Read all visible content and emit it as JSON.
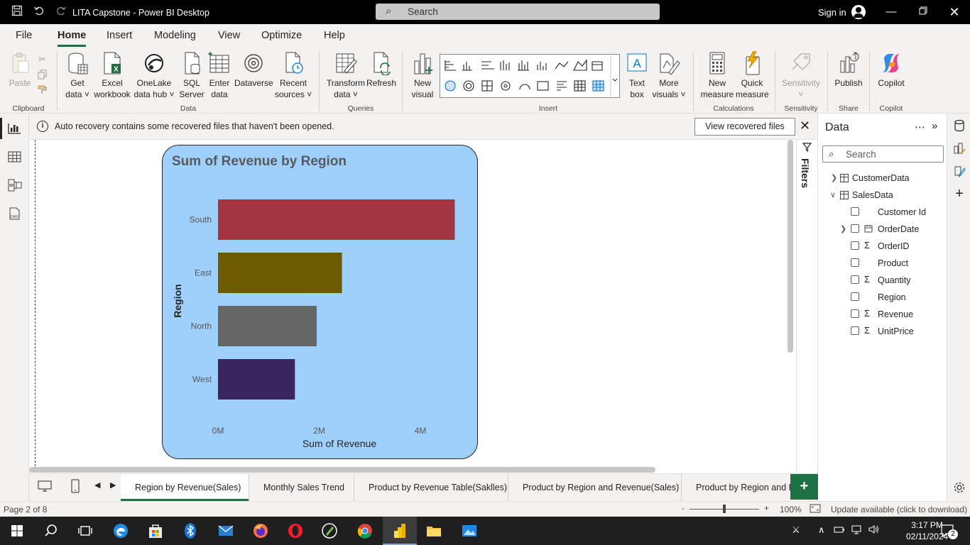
{
  "window": {
    "title": "LITA Capstone - Power BI Desktop",
    "search_placeholder": "Search",
    "sign_in": "Sign in"
  },
  "menu": {
    "tabs": [
      "File",
      "Home",
      "Insert",
      "Modeling",
      "View",
      "Optimize",
      "Help"
    ],
    "active": "Home"
  },
  "ribbon": {
    "clipboard": {
      "paste": "Paste",
      "group": "Clipboard"
    },
    "data": {
      "get_data": [
        "Get",
        "data ˅"
      ],
      "excel": [
        "Excel",
        "workbook"
      ],
      "onelake": [
        "OneLake",
        "data hub ˅"
      ],
      "sql": [
        "SQL",
        "Server"
      ],
      "enter": [
        "Enter",
        "data"
      ],
      "dataverse": "Dataverse",
      "recent": [
        "Recent",
        "sources ˅"
      ],
      "group": "Data"
    },
    "queries": {
      "transform": [
        "Transform",
        "data ˅"
      ],
      "refresh": "Refresh",
      "group": "Queries"
    },
    "insert": {
      "new_visual": [
        "New",
        "visual"
      ],
      "text_box": [
        "Text",
        "box"
      ],
      "more_visuals": [
        "More",
        "visuals ˅"
      ],
      "group": "Insert"
    },
    "calculations": {
      "new_measure": [
        "New",
        "measure"
      ],
      "quick_measure": [
        "Quick",
        "measure"
      ],
      "group": "Calculations"
    },
    "sensitivity": {
      "label": "Sensitivity",
      "group": "Sensitivity"
    },
    "share": {
      "publish": "Publish",
      "group": "Share"
    },
    "copilot": {
      "label": "Copilot",
      "group": "Copilot"
    }
  },
  "infobar": {
    "message": "Auto recovery contains some recovered files that haven't been opened.",
    "button": "View recovered files"
  },
  "filters_label": "Filters",
  "visual": {
    "title": "Sum of Revenue by Region"
  },
  "chart_data": {
    "type": "bar",
    "orientation": "horizontal",
    "title": "Sum of Revenue by Region",
    "xlabel": "Sum of Revenue",
    "ylabel": "Region",
    "categories": [
      "South",
      "East",
      "North",
      "West"
    ],
    "values": [
      4680000,
      2450000,
      1950000,
      1520000
    ],
    "colors": [
      "#a4343f",
      "#6b5a00",
      "#666666",
      "#3b2561"
    ],
    "xticks": [
      {
        "value": 0,
        "label": "0M"
      },
      {
        "value": 2000000,
        "label": "2M"
      },
      {
        "value": 4000000,
        "label": "4M"
      }
    ],
    "xlim": [
      0,
      4800000
    ],
    "background": "#9fd0fb",
    "grid": false
  },
  "data_pane": {
    "title": "Data",
    "search_placeholder": "Search",
    "tables": [
      {
        "name": "CustomerData",
        "expanded": false
      },
      {
        "name": "SalesData",
        "expanded": true
      }
    ],
    "fields": [
      {
        "name": "Customer Id",
        "sigma": false,
        "date": false,
        "expandable": false
      },
      {
        "name": "OrderDate",
        "sigma": false,
        "date": true,
        "expandable": true
      },
      {
        "name": "OrderID",
        "sigma": true,
        "date": false,
        "expandable": false
      },
      {
        "name": "Product",
        "sigma": false,
        "date": false,
        "expandable": false
      },
      {
        "name": "Quantity",
        "sigma": true,
        "date": false,
        "expandable": false
      },
      {
        "name": "Region",
        "sigma": false,
        "date": false,
        "expandable": false
      },
      {
        "name": "Revenue",
        "sigma": true,
        "date": false,
        "expandable": false
      },
      {
        "name": "UnitPrice",
        "sigma": true,
        "date": false,
        "expandable": false
      }
    ]
  },
  "pages": {
    "tabs": [
      "Region by Revenue(Sales)",
      "Monthly Sales Trend",
      "Product by Revenue Table(Saklles)",
      "Product by Region and Revenue(Sales)",
      "Product by Region and Re"
    ],
    "active_index": 0
  },
  "status": {
    "page": "Page 2 of 8",
    "zoom": "100%",
    "zoom_minus": "-",
    "zoom_plus": "+",
    "update": "Update available (click to download)"
  },
  "taskbar": {
    "time": "3:17 PM",
    "date": "02/11/2024",
    "notifications": "2"
  },
  "colors": {
    "accent": "#1e7145",
    "visual_bg": "#9fd0fb"
  }
}
